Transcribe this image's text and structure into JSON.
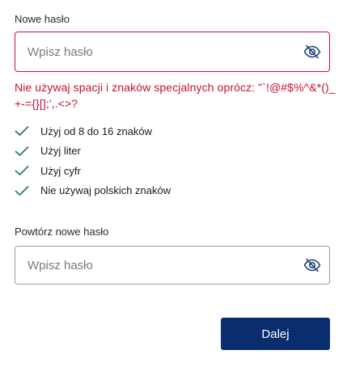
{
  "new_password": {
    "label": "Nowe hasło",
    "placeholder": "Wpisz hasło",
    "value": "",
    "toggle_icon": "eye-slash-icon",
    "error_color": "#c8102e",
    "error": "Nie używaj spacji i znaków specjalnych oprócz: \"`!@#$%^&*()_+-={}[];',.<>?"
  },
  "requirements": [
    {
      "label": "Użyj od 8 do 16 znaków",
      "icon": "check-icon",
      "met": true
    },
    {
      "label": "Użyj liter",
      "icon": "check-icon",
      "met": true
    },
    {
      "label": "Użyj cyfr",
      "icon": "check-icon",
      "met": true
    },
    {
      "label": "Nie używaj polskich znaków",
      "icon": "check-icon",
      "met": true
    }
  ],
  "repeat_password": {
    "label": "Powtórz nowe hasło",
    "placeholder": "Wpisz hasło",
    "value": "",
    "toggle_icon": "eye-slash-icon"
  },
  "submit": {
    "label": "Dalej",
    "color": "#0a2d6e"
  },
  "colors": {
    "check": "#2e7d4f",
    "icon": "#1f3f7a"
  }
}
